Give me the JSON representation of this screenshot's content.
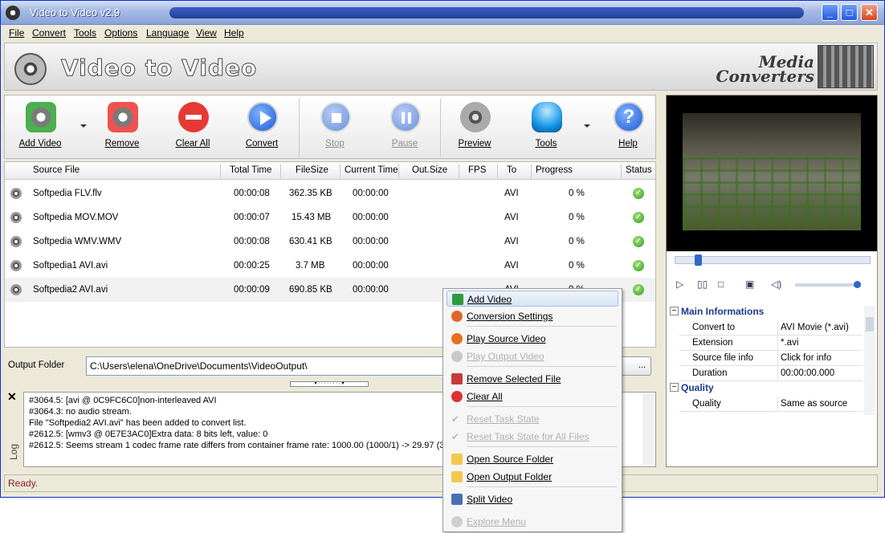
{
  "window": {
    "title": "Video to Video v2.9"
  },
  "menu": [
    "File",
    "Convert",
    "Tools",
    "Options",
    "Language",
    "View",
    "Help"
  ],
  "banner": {
    "app_name": "Video to Video",
    "brand_line1": "Media",
    "brand_line2": "Converters"
  },
  "toolbar": {
    "add": "Add Video",
    "remove": "Remove",
    "clear": "Clear All",
    "convert": "Convert",
    "stop": "Stop",
    "pause": "Pause",
    "preview": "Preview",
    "tools": "Tools",
    "help": "Help"
  },
  "grid": {
    "columns": [
      "Source File",
      "Total Time",
      "FileSize",
      "Current Time",
      "Out.Size",
      "FPS",
      "To",
      "Progress",
      "Status"
    ],
    "rows": [
      {
        "file": "Softpedia FLV.flv",
        "total": "00:00:08",
        "size": "362.35 KB",
        "current": "00:00:00",
        "to": "AVI",
        "progress": "0 %"
      },
      {
        "file": "Softpedia MOV.MOV",
        "total": "00:00:07",
        "size": "15.43 MB",
        "current": "00:00:00",
        "to": "AVI",
        "progress": "0 %"
      },
      {
        "file": "Softpedia WMV.WMV",
        "total": "00:00:08",
        "size": "630.41 KB",
        "current": "00:00:00",
        "to": "AVI",
        "progress": "0 %"
      },
      {
        "file": "Softpedia1 AVI.avi",
        "total": "00:00:25",
        "size": "3.7 MB",
        "current": "00:00:00",
        "to": "AVI",
        "progress": "0 %"
      },
      {
        "file": "Softpedia2 AVI.avi",
        "total": "00:00:09",
        "size": "690.85 KB",
        "current": "00:00:00",
        "to": "AVI",
        "progress": "0 %"
      }
    ]
  },
  "output": {
    "label": "Output Folder",
    "path": "C:\\Users\\elena\\OneDrive\\Documents\\VideoOutput\\",
    "browse": "..."
  },
  "log": {
    "title": "Log",
    "lines": [
      "#3064.5: [avi @ 0C9FC6C0]non-interleaved AVI",
      "#3064.3: no audio stream.",
      "File \"Softpedia2 AVI.avi\" has been added to convert list.",
      "#2612.5: [wmv3 @ 0E7E3AC0]Extra data: 8 bits left, value: 0",
      "#2612.5: Seems stream 1 codec frame rate differs from container frame rate: 1000.00 (1000/1) -> 29.97 (30000/1001)"
    ]
  },
  "status": "Ready.",
  "properties": {
    "section1": "Main Informations",
    "main": [
      {
        "k": "Convert to",
        "v": "AVI Movie (*.avi)"
      },
      {
        "k": "Extension",
        "v": "*.avi"
      },
      {
        "k": "Source file info",
        "v": "Click for info"
      },
      {
        "k": "Duration",
        "v": "00:00:00.000"
      }
    ],
    "section2": "Quality",
    "quality": [
      {
        "k": "Quality",
        "v": "Same as source"
      }
    ]
  },
  "context_menu": [
    {
      "label": "Add Video",
      "enabled": true
    },
    {
      "label": "Conversion Settings",
      "enabled": true
    },
    {
      "label": "Play Source Video",
      "enabled": true
    },
    {
      "label": "Play Output Video",
      "enabled": false
    },
    {
      "label": "Remove Selected File",
      "enabled": true
    },
    {
      "label": "Clear All",
      "enabled": true
    },
    {
      "label": "Reset Task State",
      "enabled": false
    },
    {
      "label": "Reset Task State for All Files",
      "enabled": false
    },
    {
      "label": "Open Source Folder",
      "enabled": true
    },
    {
      "label": "Open Output Folder",
      "enabled": true
    },
    {
      "label": "Split Video",
      "enabled": true
    },
    {
      "label": "Explore Menu",
      "enabled": false
    }
  ]
}
